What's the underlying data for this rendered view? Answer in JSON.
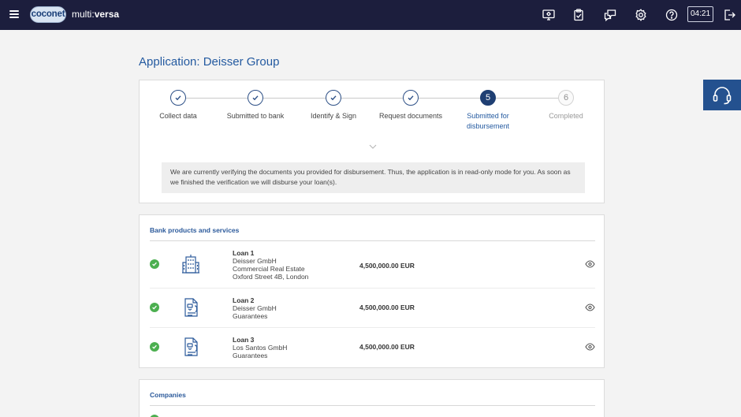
{
  "header": {
    "logo_badge": "coconet",
    "logo_prefix": "multi",
    "logo_suffix": "versa",
    "timer": "04:21",
    "icons": [
      "monitor-settings-icon",
      "clipboard-check-icon",
      "chat-icon",
      "gear-icon",
      "help-icon",
      "logout-icon"
    ]
  },
  "page": {
    "title": "Application: Deisser Group"
  },
  "steps": [
    {
      "label": "Collect data",
      "state": "done"
    },
    {
      "label": "Submitted to bank",
      "state": "done"
    },
    {
      "label": "Identify & Sign",
      "state": "done"
    },
    {
      "label": "Request documents",
      "state": "done"
    },
    {
      "number": "5",
      "label_line1": "Submitted for",
      "label_line2": "disbursement",
      "state": "active"
    },
    {
      "number": "6",
      "label": "Completed",
      "state": "future"
    }
  ],
  "notice": {
    "line1": "We are currently verifying the documents you provided for disbursement. Thus, the application is in read-only mode for you. As soon as",
    "line2": "we finished the verification we will disburse your loan(s)."
  },
  "products": {
    "title": "Bank products and services",
    "rows": [
      {
        "title": "Loan 1",
        "line1": "Deisser GmbH",
        "line2": "Commercial Real Estate",
        "line3": "Oxford Street 4B, London",
        "amount": "4,500,000.00 EUR",
        "icon": "building-icon"
      },
      {
        "title": "Loan 2",
        "line1": "Deisser GmbH",
        "line2": "Guarantees",
        "amount": "4,500,000.00 EUR",
        "icon": "guarantee-document-icon"
      },
      {
        "title": "Loan 3",
        "line1": "Los Santos GmbH",
        "line2": "Guarantees",
        "amount": "4,500,000.00 EUR",
        "icon": "guarantee-document-icon"
      }
    ]
  },
  "companies": {
    "title": "Companies"
  },
  "colors": {
    "topbar": "#1c1e3d",
    "accent": "#245aa0",
    "success": "#4caf50",
    "support": "#24518f"
  }
}
